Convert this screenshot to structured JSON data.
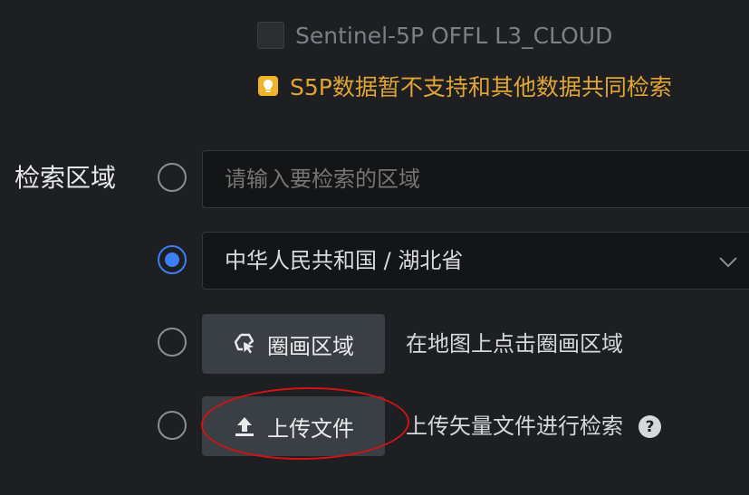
{
  "dataset": {
    "label": "Sentinel-5P OFFL L3_CLOUD",
    "checked": false
  },
  "tip": {
    "icon": "lightbulb-icon",
    "text": "S5P数据暂不支持和其他数据共同检索",
    "color": "#e0a532"
  },
  "region": {
    "label": "检索区域",
    "search_input": {
      "placeholder": "请输入要检索的区域",
      "value": ""
    },
    "admin_select": {
      "value": "中华人民共和国 / 湖北省",
      "icon": "chevron-down-icon"
    },
    "draw": {
      "button_label": "圈画区域",
      "icon": "draw-polygon-cursor-icon",
      "hint": "在地图上点击圈画区域"
    },
    "upload": {
      "button_label": "上传文件",
      "icon": "upload-icon",
      "hint": "上传矢量文件进行检索",
      "help_icon": "help-circle-icon",
      "help_glyph": "?"
    },
    "selected_option": "admin_select"
  },
  "colors": {
    "accent": "#3d7ef5",
    "annotation": "#d31313"
  }
}
